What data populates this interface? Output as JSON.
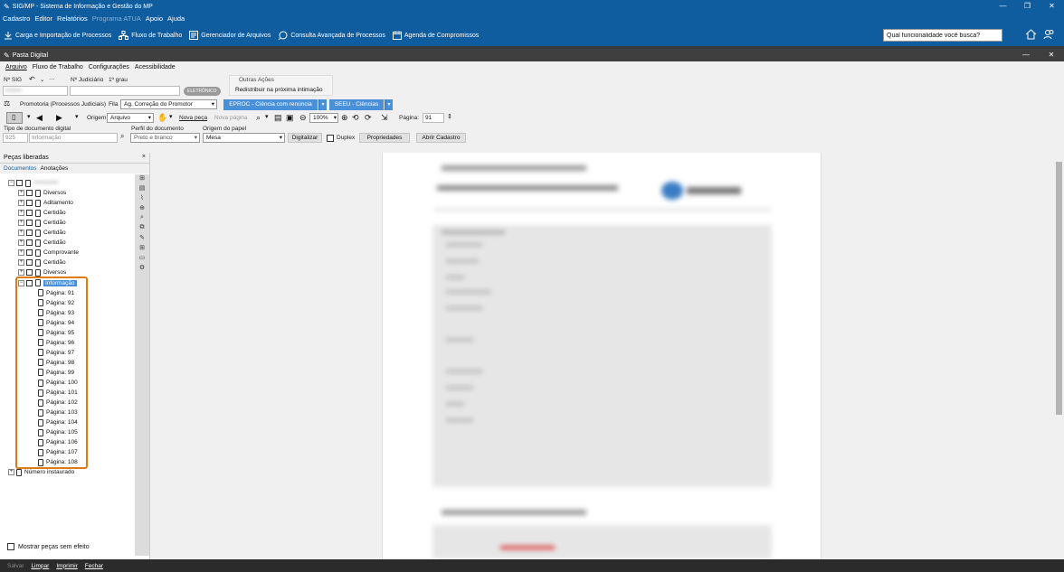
{
  "app": {
    "title": "SIG/MP - Sistema de Informação e Gestão do MP"
  },
  "menubar": [
    "Cadastro",
    "Editor",
    "Relatórios",
    "Programa ATUA",
    "Apoio",
    "Ajuda"
  ],
  "toolbar": {
    "items": [
      "Carga e Importação de Processos",
      "Fluxo de Trabalho",
      "Gerenciador de Arquivos",
      "Consulta Avançada de Processos",
      "Agenda de Compromissos"
    ],
    "search_value": "Qual funcionalidade você busca?"
  },
  "subwindow": {
    "title": "Pasta Digital",
    "menu": [
      "Arquivo",
      "Fluxo de Trabalho",
      "Configurações",
      "Acessibilidade"
    ]
  },
  "form": {
    "nsig_label": "Nº SIG",
    "njud_label": "Nº Judiciário",
    "grau_label": "1º grau",
    "eletronico_badge": "ELETRÔNICO",
    "outras_acoes_label": "Outras Ações",
    "outras_acoes_item": "Redistribuir na próxima intimação",
    "promotoria_label": "Promotoria (Processos Judiciais)",
    "fila_label": "Fila",
    "fila_value": "Ag. Correção do Promotor",
    "eproc_button": "EPROC - Ciência com renúncia",
    "seeu_button": "SEEU - Ciências",
    "origem_label": "Origem",
    "origem_value": "Arquivo",
    "nova_peca": "Nova peça",
    "nova_pagina": "Nova página",
    "zoom_value": "100%",
    "pagina_label": "Página:",
    "pagina_value": "91",
    "tipo_doc_label": "Tipo de documento digital",
    "tipo_doc_code": "925",
    "tipo_doc_value": "Informação",
    "perfil_label": "Perfil do documento",
    "perfil_value": "Preto e branco",
    "origem_papel_label": "Origem do papel",
    "origem_papel_value": "Mesa",
    "digitalizar_button": "Digitalizar",
    "duplex_label": "Duplex",
    "propriedades_button": "Propriedades",
    "abrir_cadastro_button": "Abrir Cadastro"
  },
  "left_panel": {
    "title": "Peças liberadas",
    "close": "×",
    "tabs": [
      "Documentos",
      "Anotações"
    ],
    "tree_items": [
      "Diversos",
      "Aditamento",
      "Certidão",
      "Certidão",
      "Certidão",
      "Certidão",
      "Comprovante",
      "Certidão",
      "Diversos"
    ],
    "selected_item": "Informação",
    "pages": [
      "Página: 91",
      "Página: 92",
      "Página: 93",
      "Página: 94",
      "Página: 95",
      "Página: 96",
      "Página: 97",
      "Página: 98",
      "Página: 99",
      "Página: 100",
      "Página: 101",
      "Página: 102",
      "Página: 103",
      "Página: 104",
      "Página: 105",
      "Página: 106",
      "Página: 107",
      "Página: 108"
    ],
    "last_item": "Número instaurado",
    "mostrar_label": "Mostrar peças sem efeito"
  },
  "statusbar": [
    "Salvar",
    "Limpar",
    "Imprimir",
    "Fechar"
  ],
  "colors": {
    "brand": "#0f5c9e",
    "highlight": "#e07b12",
    "button_blue": "#4a90d9"
  }
}
